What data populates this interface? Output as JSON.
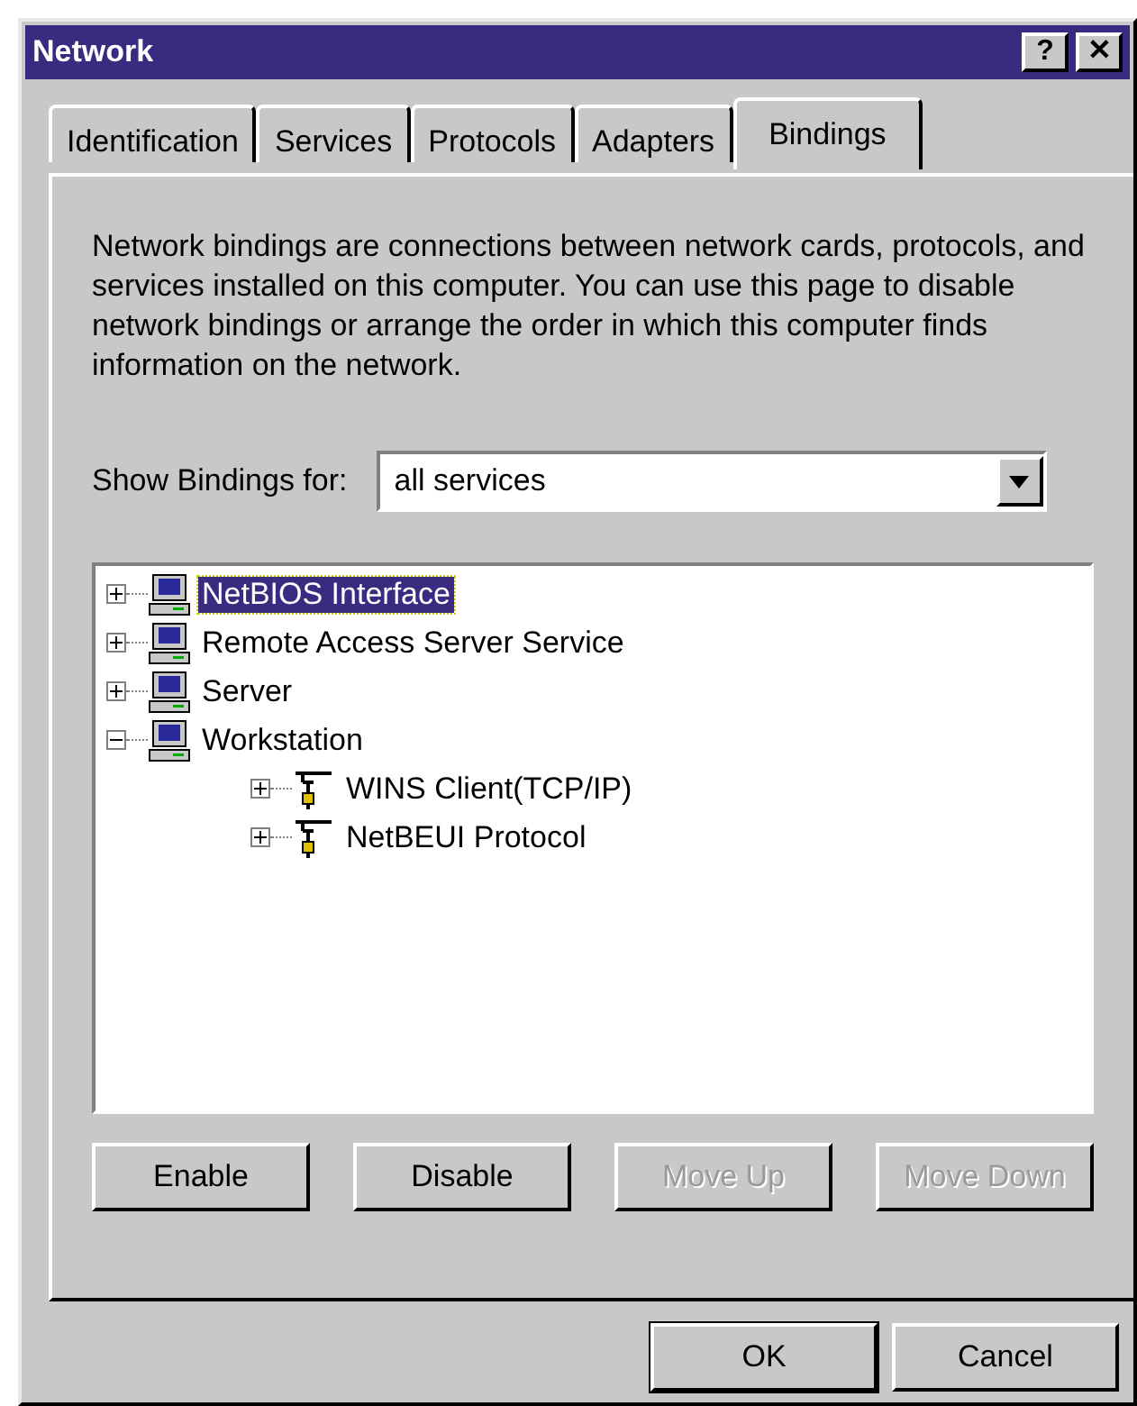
{
  "window": {
    "title": "Network",
    "help_button": "?",
    "close_button": "✕"
  },
  "tabs": [
    {
      "label": "Identification",
      "selected": false
    },
    {
      "label": "Services",
      "selected": false
    },
    {
      "label": "Protocols",
      "selected": false
    },
    {
      "label": "Adapters",
      "selected": false
    },
    {
      "label": "Bindings",
      "selected": true
    }
  ],
  "description": "Network bindings are connections between network cards, protocols, and services installed on this computer.  You can use this page to disable network bindings or arrange the order in which this computer finds information on the network.",
  "show_bindings": {
    "label": "Show Bindings for:",
    "value": "all services"
  },
  "tree": [
    {
      "label": "NetBIOS Interface",
      "kind": "service",
      "expanded": false,
      "selected": true
    },
    {
      "label": "Remote Access Server Service",
      "kind": "service",
      "expanded": false,
      "selected": false
    },
    {
      "label": "Server",
      "kind": "service",
      "expanded": false,
      "selected": false
    },
    {
      "label": "Workstation",
      "kind": "service",
      "expanded": true,
      "selected": false,
      "children": [
        {
          "label": "WINS Client(TCP/IP)",
          "kind": "protocol",
          "expanded": false,
          "selected": false
        },
        {
          "label": "NetBEUI Protocol",
          "kind": "protocol",
          "expanded": false,
          "selected": false
        }
      ]
    }
  ],
  "binding_buttons": [
    {
      "label": "Enable",
      "disabled": false
    },
    {
      "label": "Disable",
      "disabled": false
    },
    {
      "label": "Move Up",
      "disabled": true
    },
    {
      "label": "Move Down",
      "disabled": true
    }
  ],
  "dialog_buttons": [
    {
      "label": "OK",
      "default": true
    },
    {
      "label": "Cancel",
      "default": false
    }
  ]
}
